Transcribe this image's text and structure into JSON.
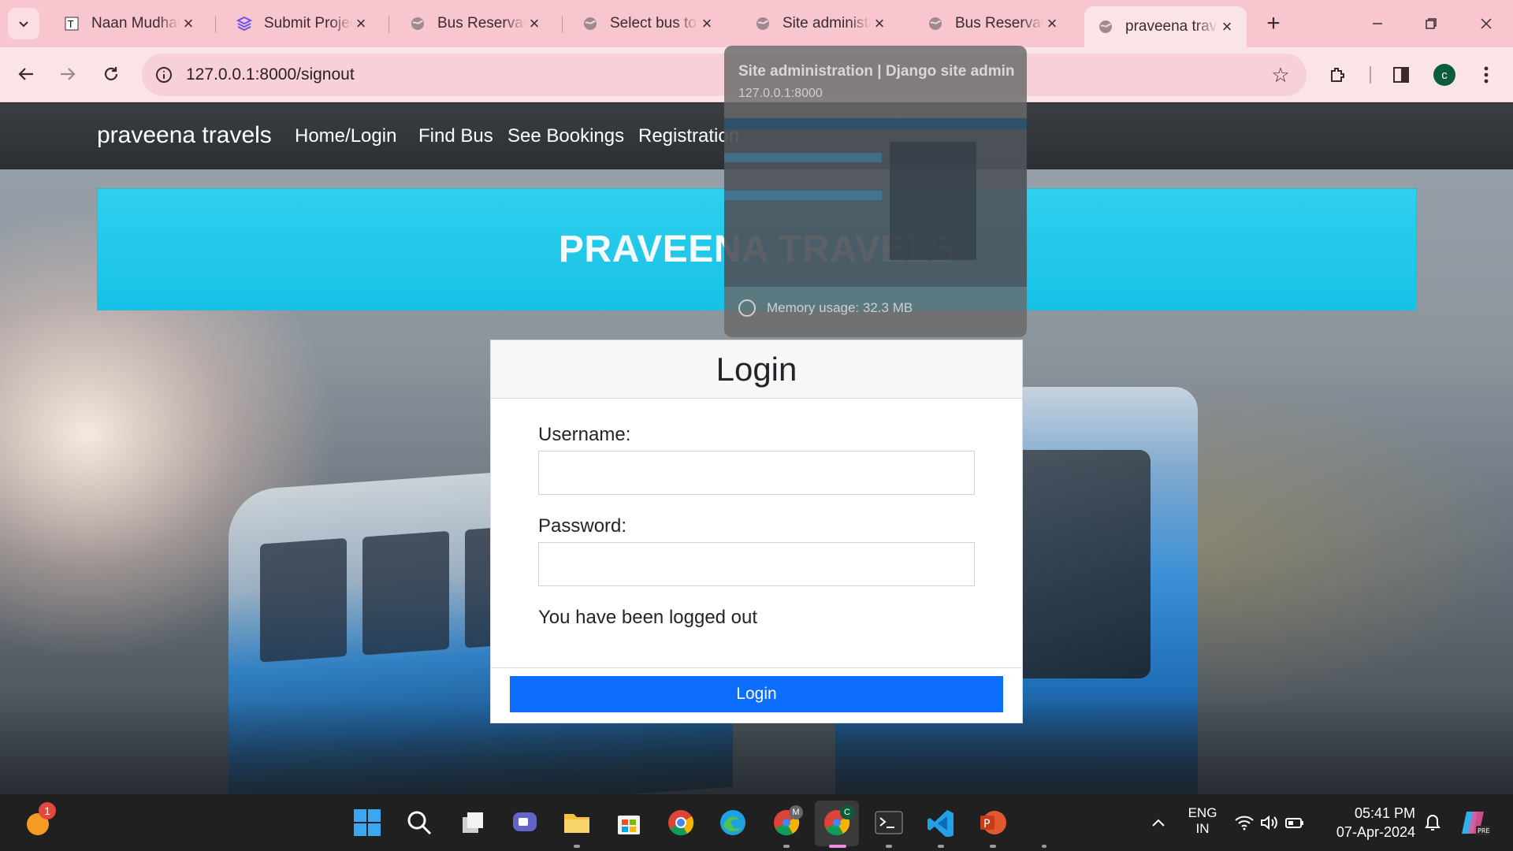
{
  "browser": {
    "tabs": [
      {
        "title": "Naan Mudhalvan",
        "icon": "naan-mudhalvan-favicon"
      },
      {
        "title": "Submit Project",
        "icon": "stack-favicon"
      },
      {
        "title": "Bus Reservation",
        "icon": "globe-icon"
      },
      {
        "title": "Select bus to confirm",
        "icon": "globe-icon"
      },
      {
        "title": "Site administration",
        "icon": "globe-icon"
      },
      {
        "title": "Bus Reservation",
        "icon": "globe-icon"
      },
      {
        "title": "praveena travels",
        "icon": "globe-icon",
        "active": true
      }
    ],
    "url": "127.0.0.1:8000/signout",
    "profile_initial": "c",
    "accent": "#f7c6cf"
  },
  "tab_preview": {
    "title": "Site administration | Django site admin",
    "url": "127.0.0.1:8000",
    "memory": "Memory usage: 32.3 MB"
  },
  "site": {
    "brand": "praveena travels",
    "nav": [
      "Home/Login",
      "Find Bus",
      "See Bookings",
      "Registration"
    ],
    "banner": "PRAVEENA TRAVELS"
  },
  "login": {
    "title": "Login",
    "username_label": "Username:",
    "password_label": "Password:",
    "message": "You have been logged out",
    "button": "Login",
    "button_color": "#0d6efd"
  },
  "taskbar": {
    "notification_count": "1",
    "language": "ENG",
    "region": "IN",
    "time": "05:41 PM",
    "date": "07-Apr-2024",
    "avatar_badges": [
      "M",
      "C"
    ]
  }
}
